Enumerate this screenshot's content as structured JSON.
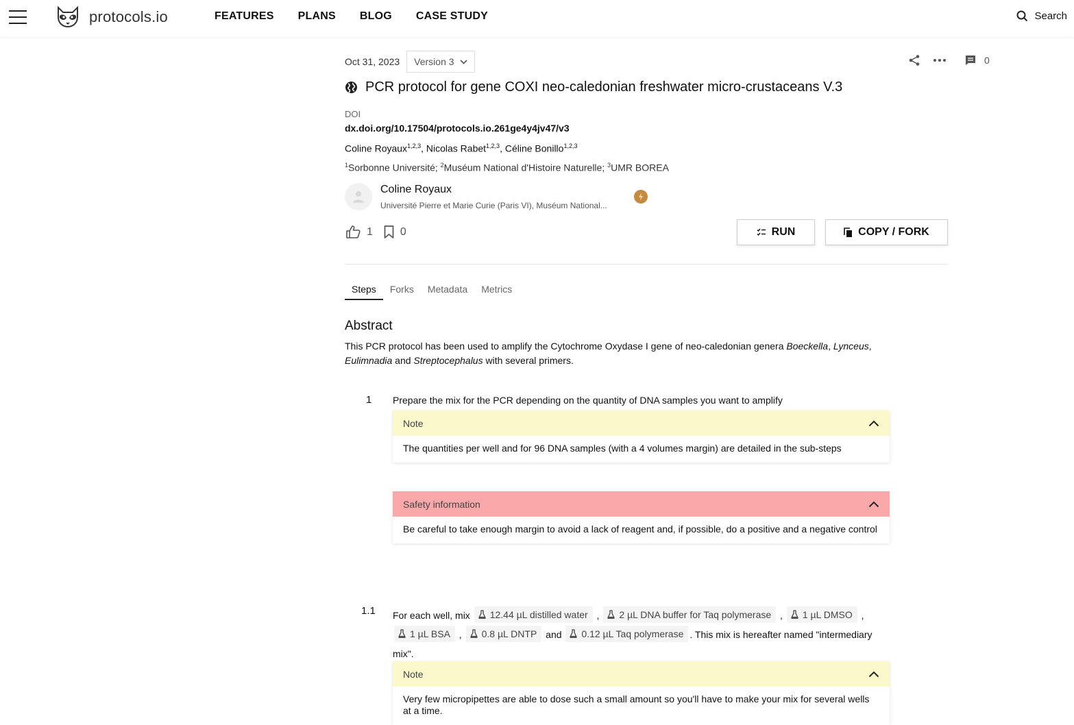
{
  "header": {
    "brand": "protocols.io",
    "nav": [
      "FEATURES",
      "PLANS",
      "BLOG",
      "CASE STUDY"
    ],
    "search_label": "Search"
  },
  "protocol": {
    "date": "Oct 31, 2023",
    "version": "Version 3",
    "comment_count": "0",
    "title": "PCR protocol for gene COXI neo-caledonian freshwater micro-crustaceans V.3",
    "doi_label": "DOI",
    "doi": "dx.doi.org/10.17504/protocols.io.261ge4y4jv47/v3",
    "authors": [
      {
        "name": "Coline Royaux",
        "sup": "1,2,3",
        "sep": ", "
      },
      {
        "name": "Nicolas Rabet",
        "sup": "1,2,3",
        "sep": ", "
      },
      {
        "name": "Céline Bonillo",
        "sup": "1,2,3",
        "sep": ""
      }
    ],
    "affiliations": [
      {
        "sup": "1",
        "name": "Sorbonne Université; "
      },
      {
        "sup": "2",
        "name": "Muséum National d'Histoire Naturelle; "
      },
      {
        "sup": "3",
        "name": "UMR BOREA"
      }
    ],
    "author_card": {
      "name": "Coline Royaux",
      "institution": "Université Pierre et Marie Curie (Paris VI), Muséum National..."
    },
    "likes": "1",
    "bookmarks": "0",
    "run_label": "RUN",
    "copy_label": "COPY / FORK"
  },
  "tabs": [
    "Steps",
    "Forks",
    "Metadata",
    "Metrics"
  ],
  "abstract": {
    "heading": "Abstract",
    "t1": "This PCR protocol has been used to amplify the Cytochrome Oxydase I gene of neo-caledonian genera ",
    "g1": "Boeckella",
    "s1": ", ",
    "g2": "Lynceus",
    "s2": ", ",
    "g3": "Eulimnadia",
    "s3": " and ",
    "g4": "Streptocephalus",
    "t2": " with several primers."
  },
  "step1": {
    "number": "1",
    "text": "Prepare the mix for the PCR depending on the quantity of DNA samples you want to amplify",
    "note_title": "Note",
    "note_body": "The quantities per well and for 96 DNA samples (with a 4 volumes margin) are detailed in the sub-steps",
    "safety_title": "Safety information",
    "safety_body": "Be careful to take enough margin to avoid a lack of reagent and, if possible, do a positive and a negative control"
  },
  "step1_1": {
    "number": "1.1",
    "intro": "For each well, mix ",
    "reagents": [
      "12.44 µL distilled water",
      "2 µL DNA buffer for Taq polymerase",
      "1 µL DMSO",
      "1 µL BSA",
      "0.8 µL DNTP",
      "0.12 µL Taq polymerase"
    ],
    "sep": " , ",
    "and": " and ",
    "outro": ". This mix is hereafter named \"intermediary mix\".",
    "note_title": "Note",
    "note_body": "Very few micropipettes are able to dose such a small amount so you'll have to make your mix for several wells at a time."
  }
}
